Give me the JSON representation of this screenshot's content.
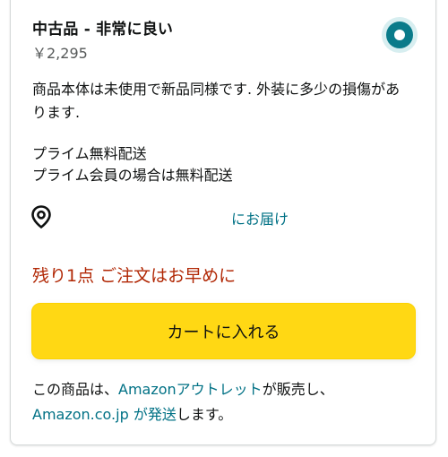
{
  "offer": {
    "condition": "中古品 - 非常に良い",
    "price": "￥2,295",
    "selected": true,
    "description": "商品本体は未使用で新品同様です. 外装に多少の損傷があります.",
    "shipping_line1": "プライム無料配送",
    "shipping_line2": "プライム会員の場合は無料配送",
    "deliver_to": "にお届け",
    "stock_message": "残り1点 ご注文はお早めに",
    "add_to_cart": "カートに入れる",
    "seller": {
      "prefix": "この商品は、",
      "seller_name": "Amazonアウトレット",
      "middle": "が販売し、",
      "fulfiller": "Amazon.co.jp が発送",
      "suffix": "します。"
    }
  },
  "colors": {
    "accent": "#007185",
    "radio": "#0a7b8a",
    "stock": "#b12704",
    "button": "#ffd814"
  },
  "icons": {
    "radio": "radio-selected-icon",
    "location": "location-pin-icon"
  }
}
